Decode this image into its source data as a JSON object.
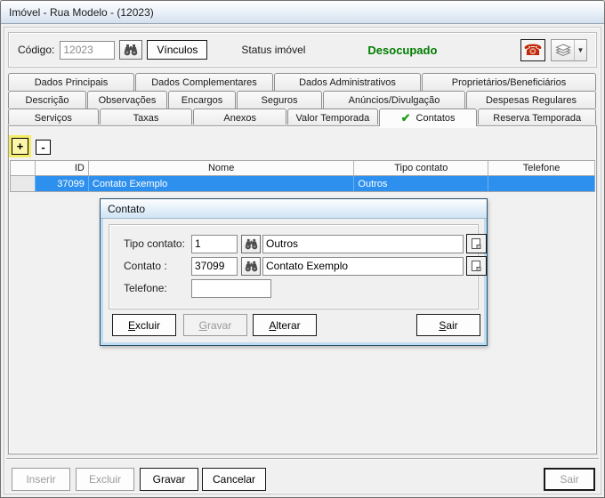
{
  "window": {
    "title": "Imóvel - Rua Modelo - (12023)"
  },
  "colors": {
    "selection": "#2e90ee",
    "status_green": "#007d00",
    "phone_red": "#c22707",
    "focus_yellow": "#f3ec67"
  },
  "icons": {
    "phone": "☎",
    "dropdown_arrow": "▼",
    "checkmark": "✔",
    "plus": "+",
    "minus": "-"
  },
  "toolbar": {
    "codigo_label": "Código:",
    "codigo_value": "12023",
    "vinculos_label": "Vínculos",
    "status_label": "Status imóvel",
    "status_value": "Desocupado"
  },
  "tabs": {
    "row1": [
      "Dados Principais",
      "Dados Complementares",
      "Dados Administrativos",
      "Proprietários/Beneficiários"
    ],
    "row2": [
      "Descrição",
      "Observações",
      "Encargos",
      "Seguros",
      "Anúncios/Divulgação",
      "Despesas Regulares"
    ],
    "row3": [
      "Serviços",
      "Taxas",
      "Anexos",
      "Valor Temporada",
      "Contatos",
      "Reserva Temporada"
    ],
    "active_tab": "Contatos"
  },
  "table": {
    "columns": [
      "ID",
      "Nome",
      "Tipo contato",
      "Telefone"
    ],
    "rows": [
      {
        "id": "37099",
        "nome": "Contato Exemplo",
        "tipo_contato": "Outros",
        "telefone": ""
      }
    ]
  },
  "dialog": {
    "title": "Contato",
    "fields": [
      {
        "label": "Tipo contato:",
        "code": "1",
        "text": "Outros"
      },
      {
        "label": "Contato :",
        "code": "37099",
        "text": "Contato Exemplo"
      },
      {
        "label": "Telefone:",
        "value": ""
      }
    ],
    "buttons": [
      {
        "ak": "E",
        "rest": "xcluir"
      },
      {
        "ak": "G",
        "rest": "ravar"
      },
      {
        "ak": "A",
        "rest": "lterar"
      },
      {
        "ak": "S",
        "rest": "air"
      }
    ]
  },
  "footer": {
    "inserir": "Inserir",
    "excluir": "Excluir",
    "gravar": "Gravar",
    "cancelar": "Cancelar",
    "sair": "Sair"
  }
}
